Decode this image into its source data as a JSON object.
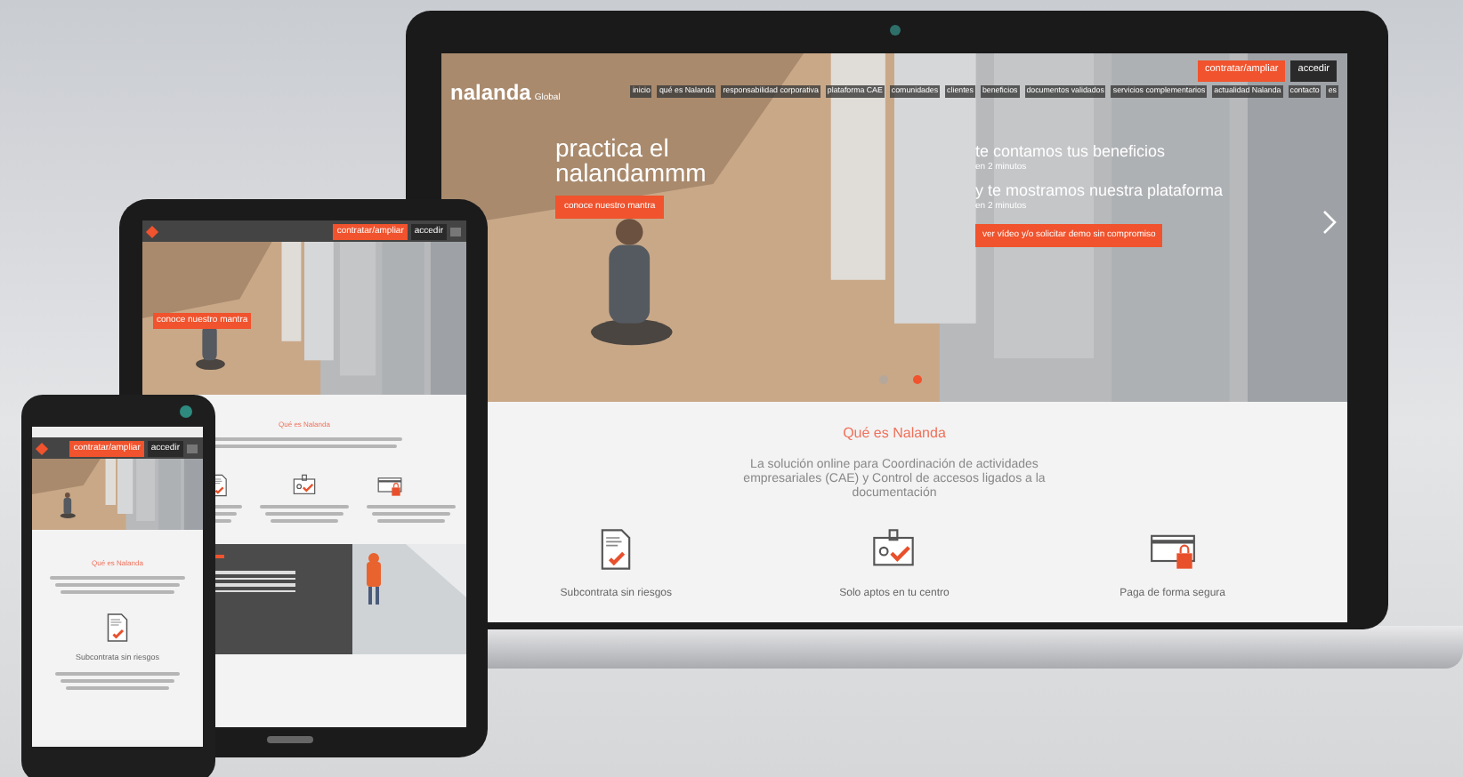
{
  "laptop": {
    "logo": "nalanda",
    "logo_suffix": "Global",
    "nav": [
      "inicio",
      "qué es Nalanda",
      "responsabilidad corporativa",
      "plataforma CAE",
      "comunidades",
      "clientes",
      "beneficios",
      "documentos validados",
      "servicios complementarios",
      "actualidad Nalanda",
      "contacto",
      "es"
    ],
    "buttons": [
      {
        "label": "contratar/ampliar",
        "kind": "primary"
      },
      {
        "label": "accedir",
        "kind": "dark"
      }
    ],
    "hero": {
      "title": "practica el nalandammm",
      "cta": "conoce nuestro mantra",
      "lines": [
        {
          "text": "te contamos tus beneficios",
          "kind": "heading"
        },
        {
          "text": "en 2 minutos",
          "kind": "sub"
        },
        {
          "text": "y te mostramos nuestra plataforma",
          "kind": "heading"
        },
        {
          "text": "en 2 minutos",
          "kind": "sub"
        }
      ],
      "right_cta": "ver vídeo y/o solicitar demo sin compromiso",
      "dots": [
        {
          "selected": false
        },
        {
          "selected": true
        }
      ]
    },
    "about": {
      "title": "Qué es Nalanda",
      "text": "La solución online para Coordinación de actividades empresariales (CAE) y Control de accesos ligados a la documentación",
      "features": [
        {
          "label": "Subcontrata sin riesgos",
          "kind": "document"
        },
        {
          "label": "Solo aptos en tu centro",
          "kind": "badge"
        },
        {
          "label": "Paga de forma segura",
          "kind": "card"
        }
      ]
    }
  },
  "tablet": {
    "buttons": [
      {
        "label": "contratar/ampliar",
        "kind": "primary"
      },
      {
        "label": "accedir",
        "kind": "dark"
      }
    ],
    "title": "Qué es Nalanda",
    "cta": "conoce nuestro mantra"
  },
  "phone": {
    "buttons": [
      {
        "label": "contratar/ampliar",
        "kind": "primary"
      },
      {
        "label": "accedir",
        "kind": "dark"
      }
    ],
    "title": "Qué es Nalanda",
    "feature": "Subcontrata sin riesgos"
  }
}
